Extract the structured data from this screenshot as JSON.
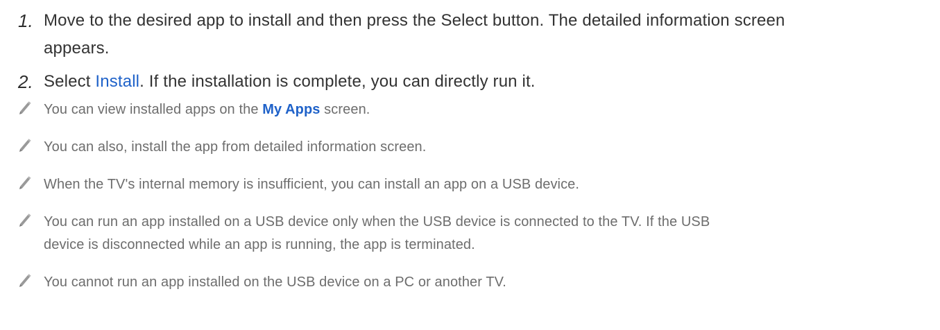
{
  "steps": [
    {
      "number": "1.",
      "line1": "Move to the desired app to install and then press the Select button. The detailed information screen",
      "line2": "appears."
    },
    {
      "number": "2.",
      "before": "Select ",
      "link": "Install",
      "after": ". If the installation is complete, you can directly run it."
    }
  ],
  "notes": [
    {
      "icon": "pencil-icon",
      "before": "You can view installed apps on the ",
      "link": "My Apps",
      "after": " screen."
    },
    {
      "icon": "pencil-icon",
      "text": "You can also, install the app from detailed information screen."
    },
    {
      "icon": "pencil-icon",
      "text": "When the TV's internal memory is insufficient, you can install an app on a USB device."
    },
    {
      "icon": "pencil-icon",
      "line1": "You can run an app installed on a USB device only when the USB device is connected to the TV. If the USB",
      "line2": "device is disconnected while an app is running, the app is terminated."
    },
    {
      "icon": "pencil-icon",
      "text": "You cannot run an app installed on the USB device on a PC or another TV."
    }
  ],
  "colors": {
    "text": "#333333",
    "note_text": "#6d6d6d",
    "link": "#1f62c9",
    "icon": "#8c8c8c"
  }
}
